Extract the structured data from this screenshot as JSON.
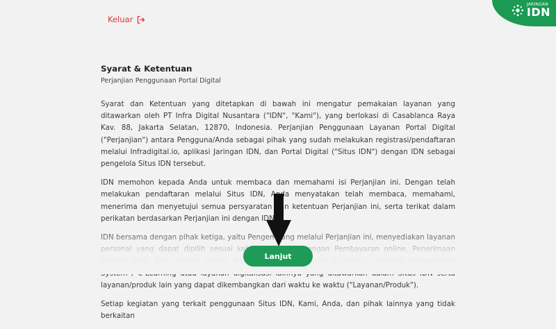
{
  "header": {
    "logout_label": "Keluar",
    "brand_small": "JARINGAN",
    "brand_big": "IDN",
    "brand_color": "#1a9a53",
    "logout_color": "#e0333d"
  },
  "terms": {
    "title": "Syarat & Ketentuan",
    "subtitle": "Perjanjian Penggunaan Portal Digital",
    "paragraphs": [
      "Syarat dan Ketentuan yang ditetapkan di bawah ini mengatur pemakaian layanan yang ditawarkan oleh PT Infra Digital Nusantara (\"IDN\", \"Kami\"), yang berlokasi di Casablanca Raya Kav. 88, Jakarta Selatan, 12870, Indonesia. Perjanjian Penggunaan Layanan Portal Digital (\"Perjanjian\") antara Pengguna/Anda sebagai pihak yang sudah melakukan registrasi/pendaftaran melalui Infradigital.io, aplikasi Jaringan IDN, dan Portal Digital (\"Situs IDN\") dengan IDN sebagai pengelola Situs IDN tersebut.",
      "IDN memohon kepada Anda untuk membaca dan memahami isi Perjanjian ini. Dengan telah melakukan pendaftaran melalui Situs IDN, Anda menyatakan telah membaca, memahami, menerima dan menyetujui semua persyaratan dan ketentuan Perjanjian ini, serta terikat dalam perikatan berdasarkan Perjanjian ini dengan IDN.",
      "IDN bersama dengan pihak ketiga, yaitu Pengembang melalui Perjanjian ini, menyediakan layanan personal yang dapat dipilih sesuai kebutuhan Anda dengan Pembayaran online, Penerimaan Peserta Didik Baru (PPDB) online, website, aplikasi laporan akuntansi, Learning Management System / e-Learning atau layanan digitalisasi lainnya yang ditawarkan dalam Situs IDN serta layanan/produk lain yang dapat dikembangkan dari waktu ke waktu (\"Layanan/Produk\").",
      "Setiap kegiatan yang terkait penggunaan Situs IDN, Kami, Anda, dan pihak lainnya yang tidak berkaitan"
    ]
  },
  "actions": {
    "continue_label": "Lanjut",
    "continue_color": "#1e9b57"
  }
}
